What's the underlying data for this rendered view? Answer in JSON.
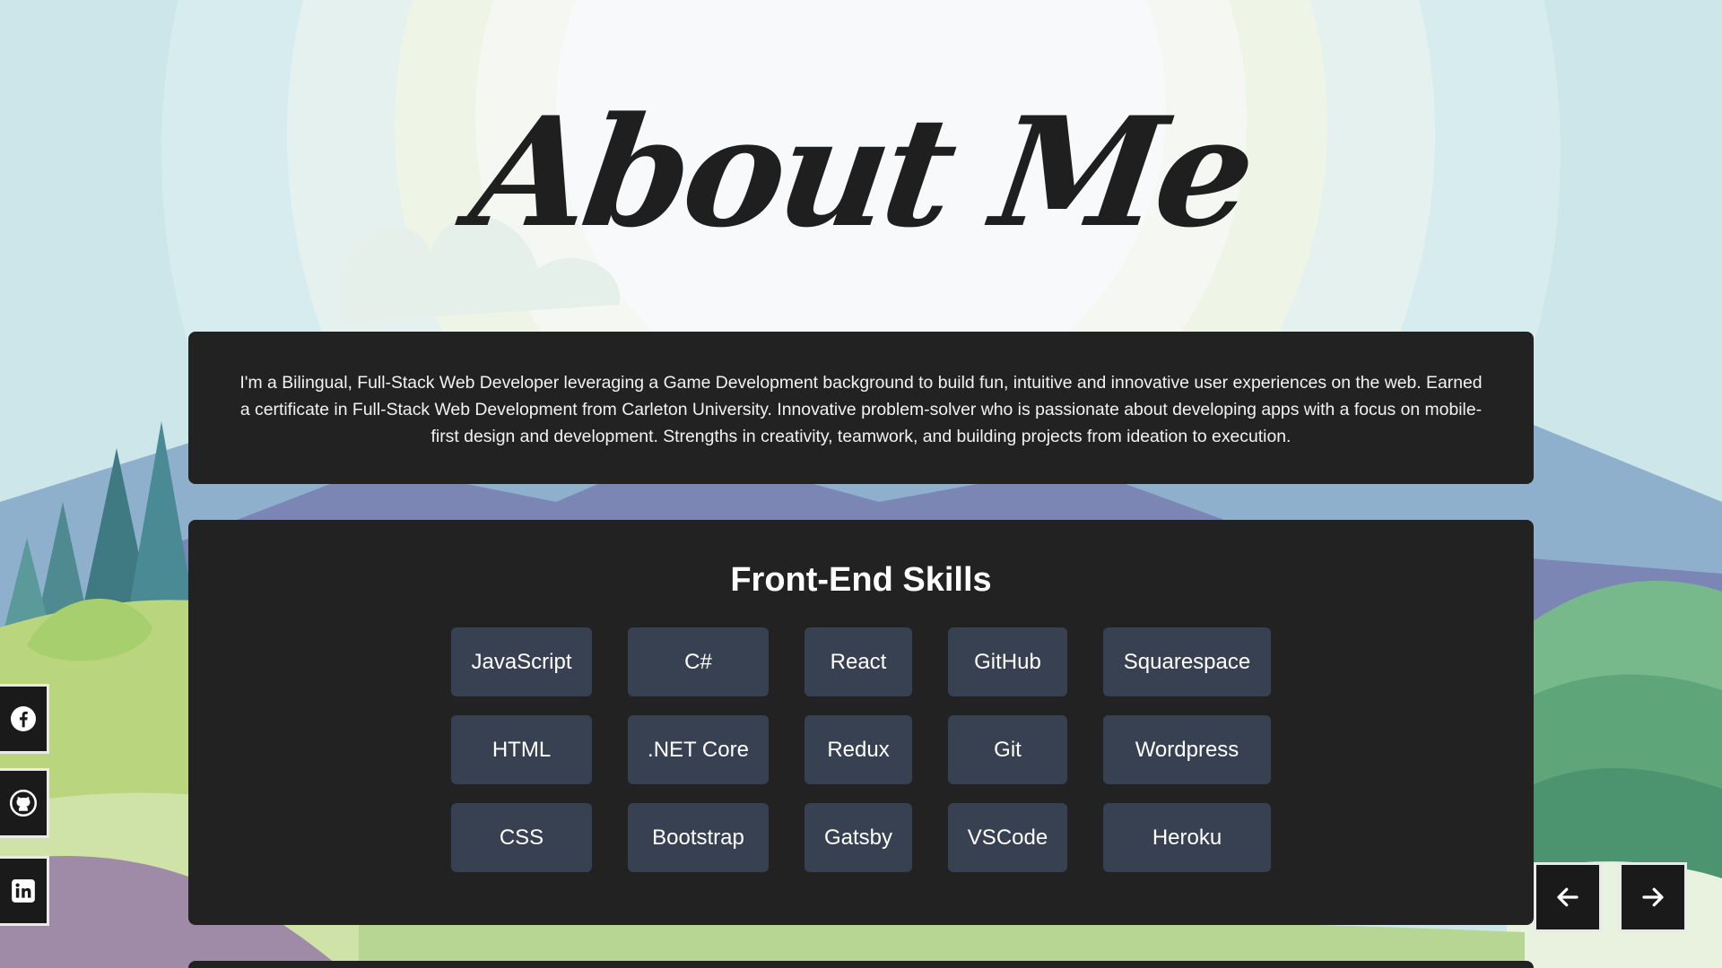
{
  "page": {
    "title": "About Me"
  },
  "bio": {
    "text": "I'm a Bilingual, Full-Stack Web Developer leveraging a Game Development background to build fun, intuitive and innovative user experiences on the web. Earned a certificate in Full-Stack Web Development from Carleton University. Innovative problem-solver who is passionate about developing apps with a focus on mobile-first design and development. Strengths in creativity, teamwork, and building projects from ideation to execution."
  },
  "skills": {
    "title": "Front-End Skills",
    "items": [
      "JavaScript",
      "C#",
      "React",
      "GitHub",
      "Squarespace",
      "HTML",
      ".NET Core",
      "Redux",
      "Git",
      "Wordpress",
      "CSS",
      "Bootstrap",
      "Gatsby",
      "VSCode",
      "Heroku"
    ]
  },
  "social": {
    "icons": [
      "facebook-icon",
      "github-icon",
      "linkedin-icon"
    ]
  },
  "navigation": {
    "icons": [
      "arrow-left-icon",
      "arrow-right-icon"
    ]
  },
  "colors": {
    "card": "#222222",
    "skill_chip": "#374151",
    "title": "#1f1f1f"
  }
}
